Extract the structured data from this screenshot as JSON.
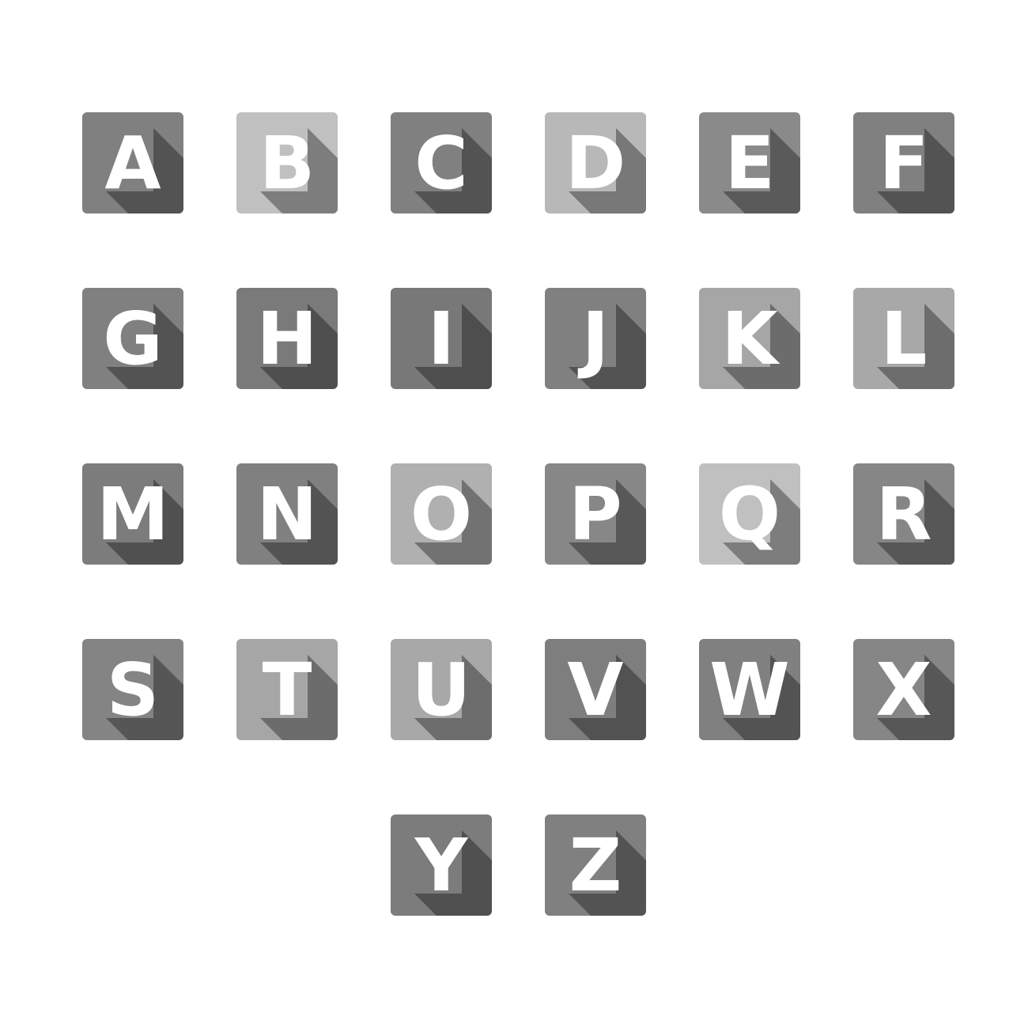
{
  "page": {
    "background": "#ffffff",
    "letter_color": "#ffffff",
    "shadow_color": "#000000"
  },
  "tiles": [
    {
      "letter": "A",
      "color": "#808080"
    },
    {
      "letter": "B",
      "color": "#c0c0c0"
    },
    {
      "letter": "C",
      "color": "#808080"
    },
    {
      "letter": "D",
      "color": "#b8b8b8"
    },
    {
      "letter": "E",
      "color": "#8a8a8a"
    },
    {
      "letter": "F",
      "color": "#808080"
    },
    {
      "letter": "G",
      "color": "#808080"
    },
    {
      "letter": "H",
      "color": "#7a7a7a"
    },
    {
      "letter": "I",
      "color": "#787878"
    },
    {
      "letter": "J",
      "color": "#808080"
    },
    {
      "letter": "K",
      "color": "#a6a6a6"
    },
    {
      "letter": "L",
      "color": "#a8a8a8"
    },
    {
      "letter": "M",
      "color": "#7c7c7c"
    },
    {
      "letter": "N",
      "color": "#808080"
    },
    {
      "letter": "O",
      "color": "#b0b0b0"
    },
    {
      "letter": "P",
      "color": "#878787"
    },
    {
      "letter": "Q",
      "color": "#c0c0c0"
    },
    {
      "letter": "R",
      "color": "#868686"
    },
    {
      "letter": "S",
      "color": "#848484"
    },
    {
      "letter": "T",
      "color": "#a6a6a6"
    },
    {
      "letter": "U",
      "color": "#a8a8a8"
    },
    {
      "letter": "V",
      "color": "#7e7e7e"
    },
    {
      "letter": "W",
      "color": "#808080"
    },
    {
      "letter": "X",
      "color": "#868686"
    },
    {
      "letter": "Y",
      "color": "#7c7c7c"
    },
    {
      "letter": "Z",
      "color": "#808080"
    }
  ]
}
